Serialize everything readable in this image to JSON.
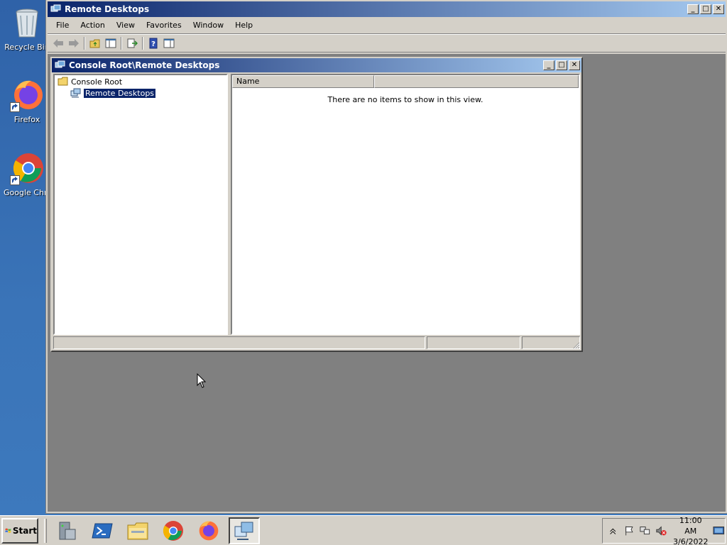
{
  "desktop": {
    "icons": [
      {
        "label": "Recycle Bin",
        "icon": "recycle-bin-icon"
      },
      {
        "label": "Firefox",
        "icon": "firefox-icon"
      },
      {
        "label": "Google Chrome",
        "icon": "chrome-icon"
      }
    ]
  },
  "main_window": {
    "title": "Remote Desktops",
    "menu": [
      "File",
      "Action",
      "View",
      "Favorites",
      "Window",
      "Help"
    ],
    "toolbar": [
      "back-icon",
      "forward-icon",
      "up-folder-icon",
      "show-hide-tree-icon",
      "export-list-icon",
      "help-icon",
      "show-hide-action-pane-icon"
    ]
  },
  "child_window": {
    "title": "Console Root\\Remote Desktops",
    "tree": [
      {
        "label": "Console Root",
        "icon": "folder-icon",
        "selected": false
      },
      {
        "label": "Remote Desktops",
        "icon": "remote-desktops-icon",
        "selected": true
      }
    ],
    "list": {
      "columns": [
        "Name",
        ""
      ],
      "empty_message": "There are no items to show in this view."
    }
  },
  "taskbar": {
    "start_label": "Start",
    "apps": [
      "server-manager-icon",
      "powershell-icon",
      "explorer-icon",
      "chrome-icon",
      "firefox-icon",
      "remote-desktops-icon"
    ],
    "active_app": "remote-desktops-icon",
    "clock": {
      "time": "11:00 AM",
      "date": "3/6/2022"
    }
  },
  "colors": {
    "title_active": "#0a246a",
    "desktop": "#3a6ea5",
    "face": "#d4d0c8"
  }
}
